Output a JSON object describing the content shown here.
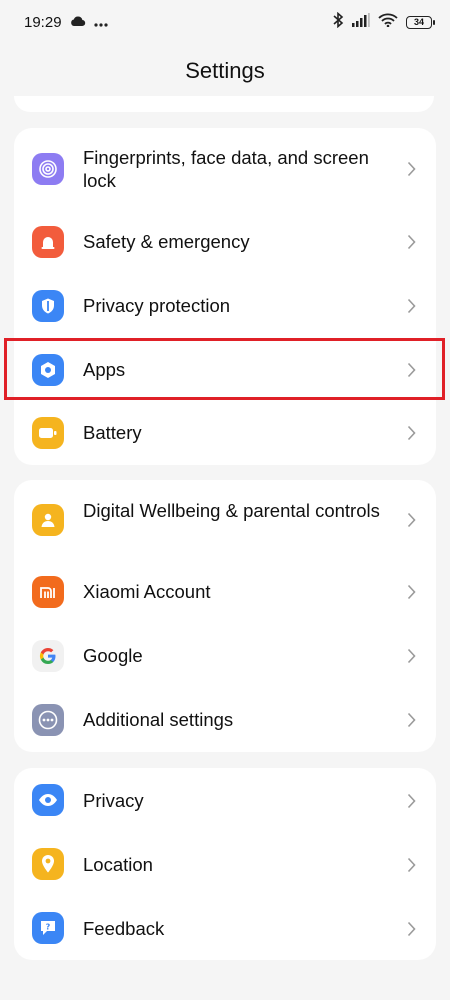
{
  "status_bar": {
    "time": "19:29",
    "battery_level": "34",
    "icons": [
      "cloud-icon",
      "more-dots-icon",
      "bluetooth-icon",
      "signal-icon",
      "wifi-icon",
      "battery-icon"
    ]
  },
  "header": {
    "title": "Settings"
  },
  "groups": [
    {
      "items": [
        {
          "label": "Fingerprints, face data, and screen lock",
          "icon": "fingerprint-icon",
          "color": "#8d7cf2"
        },
        {
          "label": "Safety & emergency",
          "icon": "alarm-icon",
          "color": "#f25c3c"
        },
        {
          "label": "Privacy protection",
          "icon": "shield-icon",
          "color": "#3b86f5"
        },
        {
          "label": "Apps",
          "icon": "apps-icon",
          "color": "#3b86f5",
          "highlighted": true
        },
        {
          "label": "Battery",
          "icon": "battery-icon",
          "color": "#f5b41f"
        }
      ]
    },
    {
      "items": [
        {
          "label": "Digital Wellbeing & parental controls",
          "icon": "wellbeing-icon",
          "color": "#f5b41f"
        },
        {
          "label": "Xiaomi Account",
          "icon": "mi-icon",
          "color": "#f26b1d"
        },
        {
          "label": "Google",
          "icon": "google-icon",
          "color": "#f1f1f1"
        },
        {
          "label": "Additional settings",
          "icon": "more-dots-icon",
          "color": "#8a93b3"
        }
      ]
    },
    {
      "items": [
        {
          "label": "Privacy",
          "icon": "eye-icon",
          "color": "#3b86f5"
        },
        {
          "label": "Location",
          "icon": "location-pin-icon",
          "color": "#f5b41f"
        },
        {
          "label": "Feedback",
          "icon": "feedback-icon",
          "color": "#3b86f5"
        }
      ]
    }
  ],
  "colors": {
    "background": "#f5f5f5",
    "card": "#ffffff",
    "highlight_border": "#e02027",
    "chevron": "#9a9a9a"
  }
}
